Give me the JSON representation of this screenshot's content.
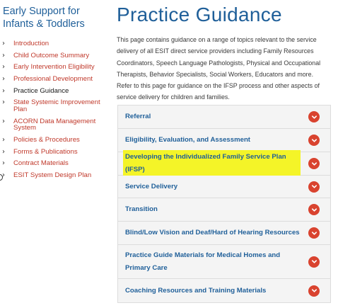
{
  "sidebar": {
    "section_title": "Early Support for Infants & Toddlers",
    "items": [
      {
        "label": "Introduction"
      },
      {
        "label": "Child Outcome Summary"
      },
      {
        "label": "Early Intervention Eligibility"
      },
      {
        "label": "Professional Development"
      },
      {
        "label": "Practice Guidance"
      },
      {
        "label": "State Systemic Improvement Plan"
      },
      {
        "label": "ACORN Data Management System"
      },
      {
        "label": "Policies & Procedures"
      },
      {
        "label": "Forms & Publications"
      },
      {
        "label": "Contract Materials"
      },
      {
        "label": "ESIT System Design Plan"
      }
    ],
    "active_index": 4,
    "chevron_glyph": "›"
  },
  "main": {
    "title": "Practice Guidance",
    "intro": "This page contains guidance on a range of topics relevant to the service delivery of all ESIT direct service providers including Family Resources Coordinators, Speech Language Pathologists, Physical and Occupational Therapists, Behavior Specialists, Social Workers, Educators and more. Refer to this page for guidance on the IFSP process and other aspects of service delivery for children and families.",
    "accordion": [
      {
        "label": "Referral"
      },
      {
        "label": "Eligibility, Evaluation, and Assessment"
      },
      {
        "label": "Developing the Individualized Family Service Plan (IFSP)",
        "highlighted": true
      },
      {
        "label": "Service Delivery"
      },
      {
        "label": "Transition"
      },
      {
        "label": "Blind/Low Vision and Deaf/Hard of Hearing Resources"
      },
      {
        "label": "Practice Guide Materials for Medical Homes and Primary Care"
      },
      {
        "label": "Coaching Resources and Training Materials"
      }
    ]
  },
  "colors": {
    "heading_blue": "#1f5f99",
    "link_red": "#c0392b",
    "button_red": "#d9432f",
    "highlight_yellow": "#f4f428",
    "panel_bg": "#f4f4f4"
  },
  "icons": {
    "nav_bullet": "chevron-right-icon",
    "accordion_toggle": "chevron-down-icon"
  }
}
